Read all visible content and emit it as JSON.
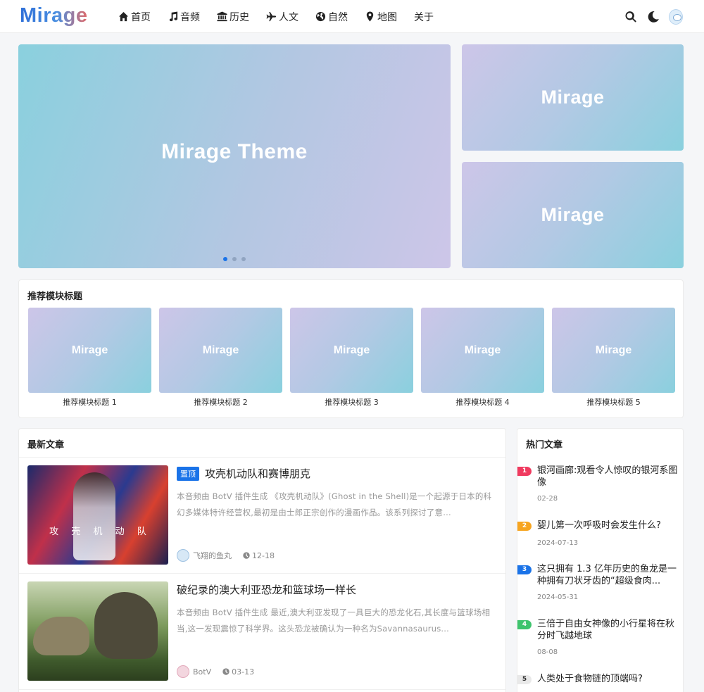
{
  "header": {
    "logo": "Mirage",
    "nav": [
      {
        "label": "首页",
        "icon": "home-icon"
      },
      {
        "label": "音频",
        "icon": "music-icon"
      },
      {
        "label": "历史",
        "icon": "bank-icon"
      },
      {
        "label": "人文",
        "icon": "plane-icon"
      },
      {
        "label": "自然",
        "icon": "globe-icon"
      },
      {
        "label": "地图",
        "icon": "map-pin-icon"
      },
      {
        "label": "关于",
        "icon": ""
      }
    ],
    "icons": [
      "search-icon",
      "moon-icon",
      "user-avatar"
    ]
  },
  "hero": {
    "main_title": "Mirage Theme",
    "side_top": "Mirage",
    "side_bottom": "Mirage",
    "slides": 3,
    "active_slide": 1
  },
  "recommend": {
    "title": "推荐模块标题",
    "items": [
      {
        "thumb": "Mirage",
        "label": "推荐模块标题 1"
      },
      {
        "thumb": "Mirage",
        "label": "推荐模块标题 2"
      },
      {
        "thumb": "Mirage",
        "label": "推荐模块标题 3"
      },
      {
        "thumb": "Mirage",
        "label": "推荐模块标题 4"
      },
      {
        "thumb": "Mirage",
        "label": "推荐模块标题 5"
      }
    ]
  },
  "latest": {
    "title": "最新文章",
    "posts": [
      {
        "pin": "置顶",
        "title": "攻壳机动队和赛博朋克",
        "excerpt": "本音频由 BotV 插件生成 《攻壳机动队》(Ghost in the Shell)是一个起源于日本的科幻多媒体特许经营权,最初是由士郎正宗创作的漫画作品。该系列探讨了意...",
        "image_text": [
          "攻",
          "壳",
          "机",
          "动",
          "队"
        ],
        "author": "飞翔的鱼丸",
        "date": "12-18"
      },
      {
        "pin": "",
        "title": "破纪录的澳大利亚恐龙和篮球场一样长",
        "excerpt": "本音频由 BotV 插件生成 最近,澳大利亚发现了一具巨大的恐龙化石,其长度与篮球场相当,这一发现震惊了科学界。这头恐龙被确认为一种名为Savannasaurus...",
        "image_text": [],
        "author": "BotV",
        "date": "03-13"
      }
    ]
  },
  "hot": {
    "title": "热门文章",
    "items": [
      {
        "rank": "1",
        "color": "#f03a5f",
        "title": "银河画廊:观看令人惊叹的银河系图像",
        "date": "02-28"
      },
      {
        "rank": "2",
        "color": "#f7a520",
        "title": "婴儿第一次呼吸时会发生什么?",
        "date": "2024-07-13"
      },
      {
        "rank": "3",
        "color": "#1a73e8",
        "title": "这只拥有 1.3 亿年历史的鱼龙是一种拥有刀状牙齿的“超级食肉...",
        "date": "2024-05-31"
      },
      {
        "rank": "4",
        "color": "#3ec46d",
        "title": "三倍于自由女神像的小行星将在秋分时飞越地球",
        "date": "08-08"
      },
      {
        "rank": "5",
        "color": "#e9e9e9",
        "title": "人类处于食物链的顶端吗?",
        "date": ""
      }
    ]
  }
}
